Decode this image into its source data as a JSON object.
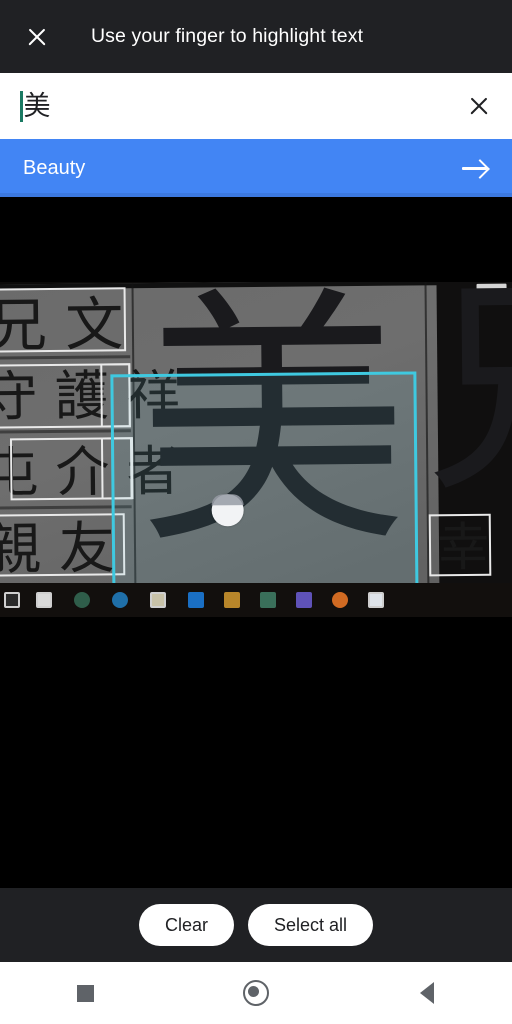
{
  "app": {
    "title": "Use your finger to highlight text",
    "close_icon": "close-icon"
  },
  "query": {
    "value": "美",
    "clear_icon": "close-icon",
    "caret_color": "#1a7a63"
  },
  "suggestion": {
    "label": "Beauty",
    "arrow_icon": "arrow-right-icon",
    "background": "#4285f4"
  },
  "capture": {
    "selection_color": "#3fc9e0",
    "touch_handle": "selection-handle",
    "highlighted_character": "美",
    "right_character": "兄",
    "ocr_boxes": [
      {
        "text": "兄 文"
      },
      {
        "text": "守 護 祥"
      },
      {
        "text": "屯 介 者"
      },
      {
        "text": "親 友"
      },
      {
        "text": "幸"
      }
    ],
    "taskbar_icons": [
      "app-icon-1",
      "app-icon-2",
      "app-icon-3",
      "app-icon-4",
      "app-icon-5",
      "app-icon-6",
      "app-icon-7",
      "app-icon-8",
      "app-icon-9",
      "app-icon-10",
      "app-icon-11"
    ],
    "taskbar_colors": [
      "#2a2a2a",
      "#d9d9d9",
      "#2f5d4a",
      "#1f6fa8",
      "#c8c2a8",
      "#1a6fc4",
      "#b8862a",
      "#3a6f5a",
      "#5f52b8",
      "#d06a22",
      "#dfe4ea"
    ]
  },
  "actions": {
    "clear_label": "Clear",
    "select_all_label": "Select all"
  },
  "navbar": {
    "recents": "recents-square-icon",
    "home": "home-circle-icon",
    "back": "back-triangle-icon"
  }
}
